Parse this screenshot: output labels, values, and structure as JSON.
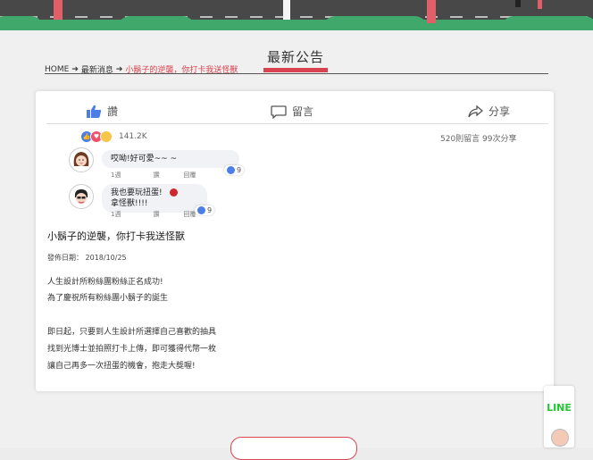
{
  "page": {
    "title": "最新公告"
  },
  "breadcrumb": {
    "home": "HOME",
    "news": "最新消息",
    "current": "小鬍子的逆襲，你打卡我送怪獸"
  },
  "social": {
    "like_label": "讚",
    "comment_label": "留言",
    "share_label": "分享",
    "reaction_count": "141.2K",
    "comments_shares": "520則留言 99次分享"
  },
  "comments": [
    {
      "text": "哎呦!好可愛~~ ~",
      "line2": "",
      "meta": {
        "date": "1週",
        "like": "讚",
        "reply": "回覆"
      },
      "likes": "9"
    },
    {
      "text": "我也要玩扭蛋!",
      "line2": "拿怪獸!!!!",
      "meta": {
        "date": "1週",
        "like": "讚",
        "reply": "回覆"
      },
      "likes": "9"
    }
  ],
  "article": {
    "title": "小鬍子的逆襲，你打卡我送怪獸",
    "date": "發佈日期： 2018/10/25",
    "paragraphs": [
      "人生設計所粉絲團粉絲正名成功!",
      "為了慶祝所有粉絲團小鬍子的誕生",
      "即日起，只要到人生設計所選擇自己喜歡的抽具",
      "找到光博士並拍照打卡上傳，即可獲得代幣一枚",
      "讓自己再多一次扭蛋的機會，抱走大獎喔!"
    ]
  },
  "line_badge": {
    "label": "LINE"
  },
  "colors": {
    "accent": "#d9434f",
    "facebook": "#4c7ee8",
    "line": "#1ec730"
  }
}
